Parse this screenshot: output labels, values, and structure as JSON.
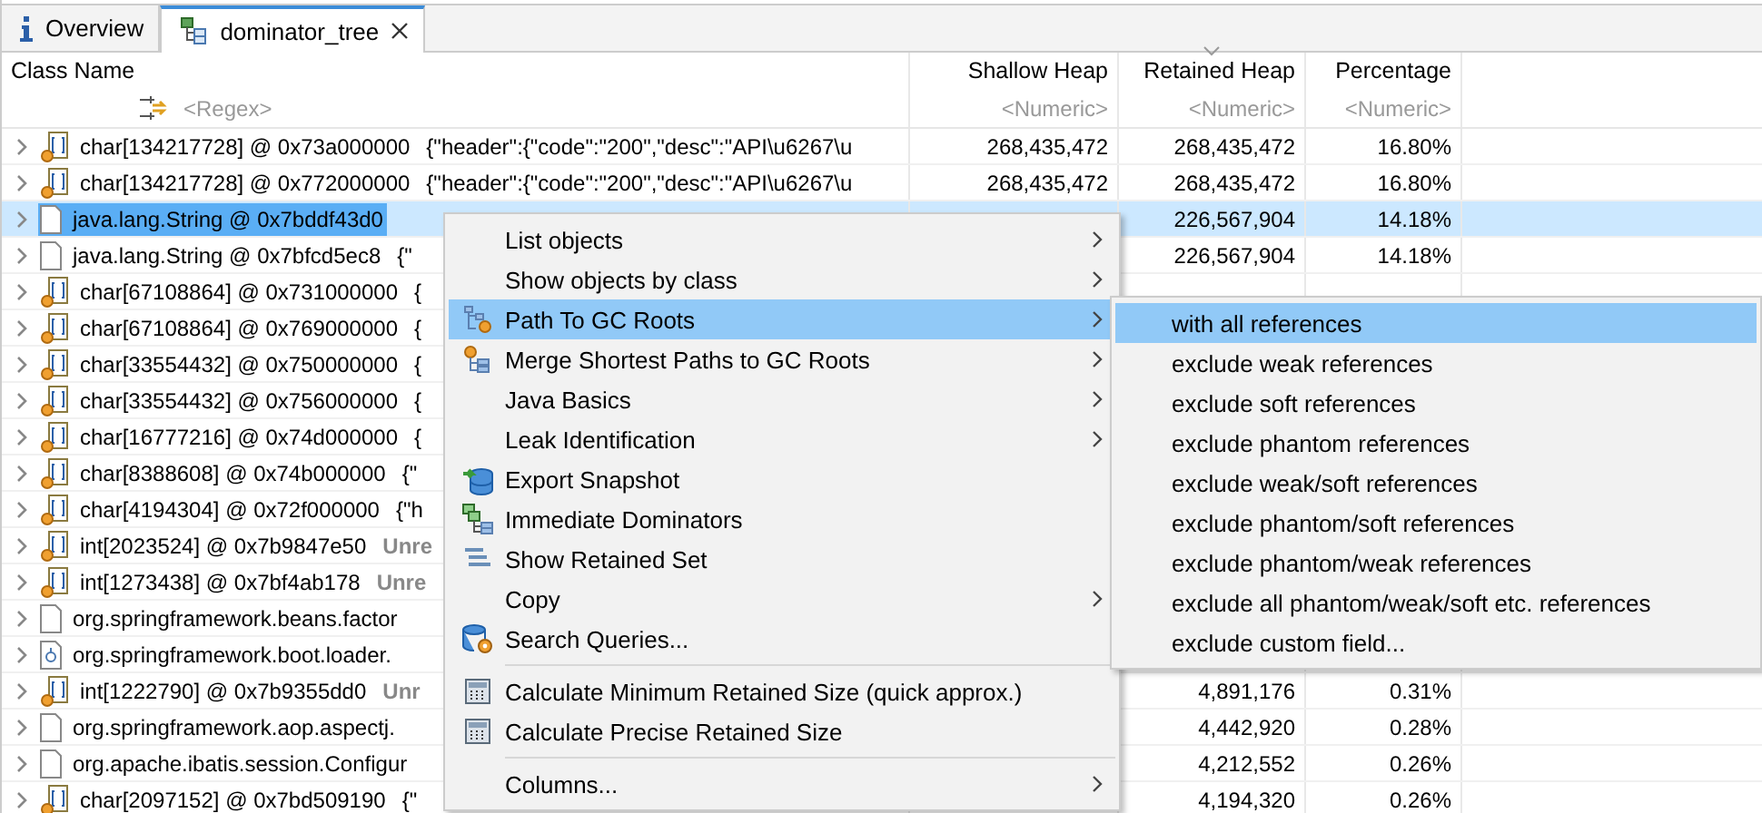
{
  "tabs": [
    {
      "label": "Overview",
      "kind": "info",
      "selected": false,
      "closable": false
    },
    {
      "label": "dominator_tree",
      "kind": "tree",
      "selected": true,
      "closable": true
    }
  ],
  "table": {
    "columns": [
      {
        "label": "Class Name",
        "placeholder": "<Regex>",
        "sorted": false
      },
      {
        "label": "Shallow Heap",
        "placeholder": "<Numeric>",
        "sorted": false
      },
      {
        "label": "Retained Heap",
        "placeholder": "<Numeric>",
        "sorted": true
      },
      {
        "label": "Percentage",
        "placeholder": "<Numeric>",
        "sorted": false
      }
    ],
    "rows": [
      {
        "name": "char[134217728] @ 0x73a000000",
        "kind": "array",
        "detail": "{\"header\":{\"code\":\"200\",\"desc\":\"API\\u6267\\u",
        "shallow": "268,435,472",
        "retained": "268,435,472",
        "percentage": "16.80%",
        "selected": false
      },
      {
        "name": "char[134217728] @ 0x772000000",
        "kind": "array",
        "detail": "{\"header\":{\"code\":\"200\",\"desc\":\"API\\u6267\\u",
        "shallow": "268,435,472",
        "retained": "268,435,472",
        "percentage": "16.80%",
        "selected": false
      },
      {
        "name": "java.lang.String @ 0x7bddf43d0",
        "kind": "object",
        "retained": "226,567,904",
        "percentage": "14.18%",
        "selected": true
      },
      {
        "name": "java.lang.String @ 0x7bfcd5ec8",
        "kind": "object",
        "detail": "{\"",
        "retained": "226,567,904",
        "percentage": "14.18%",
        "selected": false
      },
      {
        "name": "char[67108864] @ 0x731000000",
        "kind": "array",
        "detail": "{",
        "selected": false
      },
      {
        "name": "char[67108864] @ 0x769000000",
        "kind": "array",
        "detail": "{",
        "selected": false
      },
      {
        "name": "char[33554432] @ 0x750000000",
        "kind": "array",
        "detail": "{",
        "selected": false
      },
      {
        "name": "char[33554432] @ 0x756000000",
        "kind": "array",
        "detail": "{",
        "selected": false
      },
      {
        "name": "char[16777216] @ 0x74d000000",
        "kind": "array",
        "detail": "{",
        "selected": false
      },
      {
        "name": "char[8388608] @ 0x74b000000",
        "kind": "array",
        "detail": "{\"",
        "selected": false
      },
      {
        "name": "char[4194304] @ 0x72f000000",
        "kind": "array",
        "detail": "{\"h",
        "selected": false
      },
      {
        "name": "int[2023524] @ 0x7b9847e50",
        "kind": "array",
        "detail": "Unre",
        "detail_bold": true,
        "selected": false
      },
      {
        "name": "int[1273438] @ 0x7bf4ab178",
        "kind": "array",
        "detail": "Unre",
        "detail_bold": true,
        "selected": false
      },
      {
        "name": "org.springframework.beans.factor",
        "kind": "object",
        "selected": false
      },
      {
        "name": "org.springframework.boot.loader.",
        "kind": "loader",
        "selected": false
      },
      {
        "name": "int[1222790] @ 0x7b9355dd0",
        "kind": "array",
        "detail": "Unr",
        "detail_bold": true,
        "retained": "4,891,176",
        "percentage": "0.31%",
        "selected": false
      },
      {
        "name": "org.springframework.aop.aspectj.",
        "kind": "object",
        "retained": "4,442,920",
        "percentage": "0.28%",
        "selected": false
      },
      {
        "name": "org.apache.ibatis.session.Configur",
        "kind": "object",
        "retained": "4,212,552",
        "percentage": "0.26%",
        "selected": false
      },
      {
        "name": "char[2097152] @ 0x7bd509190",
        "kind": "array",
        "detail": "{\"",
        "retained": "4,194,320",
        "percentage": "0.26%",
        "selected": false
      }
    ]
  },
  "context_menu": {
    "items": [
      {
        "label": "List objects",
        "kind": "plain",
        "submenu": true,
        "separator_before": false,
        "selected": false
      },
      {
        "label": "Show objects by class",
        "kind": "plain",
        "submenu": true,
        "separator_before": false,
        "selected": false
      },
      {
        "label": "Path To GC Roots",
        "kind": "path",
        "submenu": true,
        "separator_before": false,
        "selected": true
      },
      {
        "label": "Merge Shortest Paths to GC Roots",
        "kind": "merge",
        "submenu": true,
        "separator_before": false,
        "selected": false
      },
      {
        "label": "Java Basics",
        "kind": "plain",
        "submenu": true,
        "separator_before": false,
        "selected": false
      },
      {
        "label": "Leak Identification",
        "kind": "plain",
        "submenu": true,
        "separator_before": false,
        "selected": false
      },
      {
        "label": "Export Snapshot",
        "kind": "export",
        "submenu": false,
        "separator_before": false,
        "selected": false
      },
      {
        "label": "Immediate Dominators",
        "kind": "dominators",
        "submenu": false,
        "separator_before": false,
        "selected": false
      },
      {
        "label": "Show Retained Set",
        "kind": "retained",
        "submenu": false,
        "separator_before": false,
        "selected": false
      },
      {
        "label": "Copy",
        "kind": "plain",
        "submenu": true,
        "separator_before": false,
        "selected": false
      },
      {
        "label": "Search Queries...",
        "kind": "search",
        "submenu": false,
        "separator_before": false,
        "selected": false
      },
      {
        "label": "Calculate Minimum Retained Size (quick approx.)",
        "kind": "calculator",
        "submenu": false,
        "separator_before": true,
        "selected": false
      },
      {
        "label": "Calculate Precise Retained Size",
        "kind": "calculator",
        "submenu": false,
        "separator_before": false,
        "selected": false
      },
      {
        "label": "Columns...",
        "kind": "plain",
        "submenu": true,
        "separator_before": true,
        "selected": false
      }
    ]
  },
  "submenu": {
    "items": [
      {
        "label": "with all references",
        "selected": true
      },
      {
        "label": "exclude weak references",
        "selected": false
      },
      {
        "label": "exclude soft references",
        "selected": false
      },
      {
        "label": "exclude phantom references",
        "selected": false
      },
      {
        "label": "exclude weak/soft references",
        "selected": false
      },
      {
        "label": "exclude phantom/soft references",
        "selected": false
      },
      {
        "label": "exclude phantom/weak references",
        "selected": false
      },
      {
        "label": "exclude all phantom/weak/soft etc. references",
        "selected": false
      },
      {
        "label": "exclude custom field...",
        "selected": false
      }
    ]
  }
}
